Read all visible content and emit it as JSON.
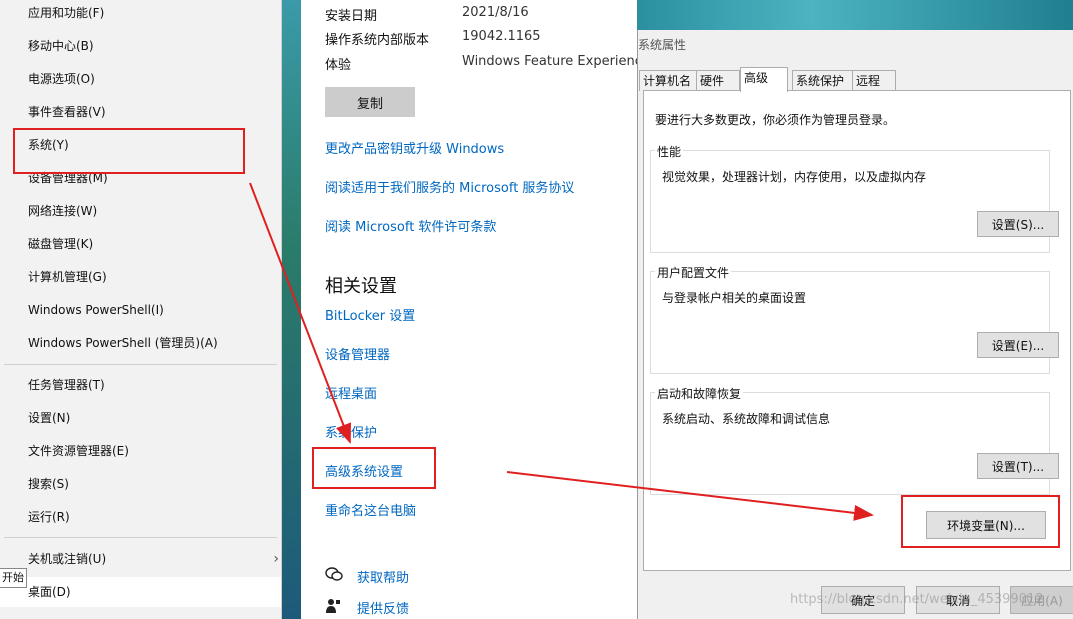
{
  "winx_menu": {
    "items": [
      {
        "label": "应用和功能(F)"
      },
      {
        "label": "移动中心(B)"
      },
      {
        "label": "电源选项(O)"
      },
      {
        "label": "事件查看器(V)"
      },
      {
        "label": "系统(Y)"
      },
      {
        "label": "设备管理器(M)"
      },
      {
        "label": "网络连接(W)"
      },
      {
        "label": "磁盘管理(K)"
      },
      {
        "label": "计算机管理(G)"
      },
      {
        "label": "Windows PowerShell(I)"
      },
      {
        "label": "Windows PowerShell (管理员)(A)"
      },
      {
        "label": "任务管理器(T)"
      },
      {
        "label": "设置(N)"
      },
      {
        "label": "文件资源管理器(E)"
      },
      {
        "label": "搜索(S)"
      },
      {
        "label": "运行(R)"
      },
      {
        "label": "关机或注销(U)"
      },
      {
        "label": "桌面(D)"
      }
    ],
    "submenu_arrow": "›",
    "start_tooltip": "开始"
  },
  "settings": {
    "specs": [
      {
        "label": "安装日期",
        "value": "2021/8/16"
      },
      {
        "label": "操作系统内部版本",
        "value": "19042.1165"
      },
      {
        "label": "体验",
        "value": "Windows Feature Experience"
      }
    ],
    "copy_label": "复制",
    "links": [
      "更改产品密钥或升级 Windows",
      "阅读适用于我们服务的 Microsoft 服务协议",
      "阅读 Microsoft 软件许可条款"
    ],
    "related_heading": "相关设置",
    "related_links": [
      "BitLocker 设置",
      "设备管理器",
      "远程桌面",
      "系统保护",
      "高级系统设置",
      "重命名这台电脑"
    ],
    "help_links": [
      "获取帮助",
      "提供反馈"
    ]
  },
  "system_properties": {
    "title": "系统属性",
    "tabs": [
      "计算机名",
      "硬件",
      "高级",
      "系统保护",
      "远程"
    ],
    "active_tab": "高级",
    "admin_note": "要进行大多数更改，你必须作为管理员登录。",
    "groups": [
      {
        "title": "性能",
        "desc": "视觉效果，处理器计划，内存使用，以及虚拟内存",
        "button": "设置(S)..."
      },
      {
        "title": "用户配置文件",
        "desc": "与登录帐户相关的桌面设置",
        "button": "设置(E)..."
      },
      {
        "title": "启动和故障恢复",
        "desc": "系统启动、系统故障和调试信息",
        "button": "设置(T)..."
      }
    ],
    "env_button": "环境变量(N)...",
    "ok_button": "确定",
    "cancel_button": "取消",
    "apply_button": "应用(A)"
  },
  "watermark": "https://blog.csdn.net/weixin_45399012",
  "colors": {
    "annotation": "#e02020",
    "link": "#0067c0"
  }
}
